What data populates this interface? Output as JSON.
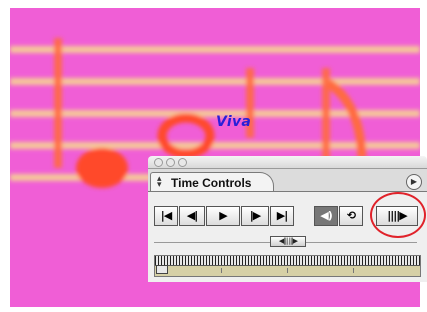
{
  "background": {
    "label": "Viva",
    "colors": {
      "pink": "#f05ed6",
      "staff_line": "#f5c79a",
      "note": "#ff4a2a",
      "label": "#2a1fd8"
    }
  },
  "palette": {
    "title": "Time Controls",
    "icons": {
      "tab_arrows": "up-down-arrows-icon",
      "menu": "palette-menu-icon"
    },
    "transport": [
      {
        "name": "go-to-start-button",
        "symbol": "|◀"
      },
      {
        "name": "step-back-button",
        "symbol": "◀|"
      },
      {
        "name": "play-button",
        "symbol": "▶"
      },
      {
        "name": "step-forward-button",
        "symbol": "|▶"
      },
      {
        "name": "go-to-end-button",
        "symbol": "▶|"
      },
      {
        "name": "audio-toggle-button",
        "symbol": "◀)"
      },
      {
        "name": "loop-button",
        "symbol": "⟲"
      },
      {
        "name": "play-every-frame-button",
        "symbol": "||||▶"
      }
    ],
    "shuttle_symbol": "◀||| |||▶",
    "highlight_color": "#e0222a"
  }
}
